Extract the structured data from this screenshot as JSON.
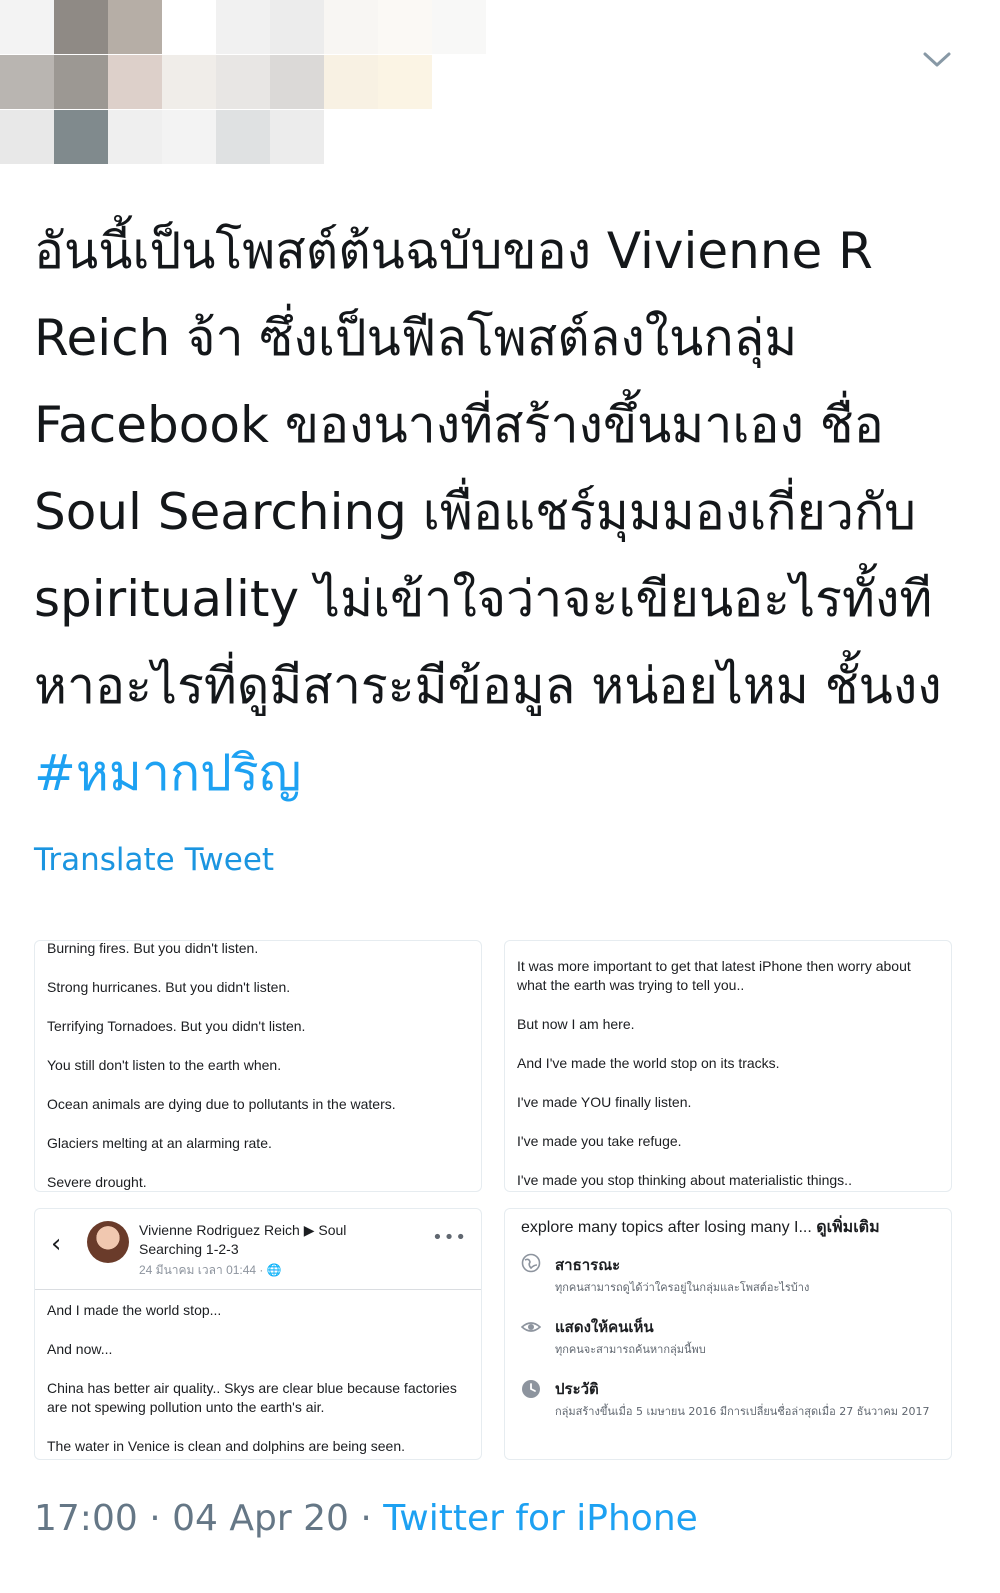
{
  "header": {
    "mosaic_colors": [
      [
        "#f3f3f3",
        "#8f8a85",
        "#b6aea6",
        "#ffffff",
        "#f1f1f1",
        "#ececec",
        "#f8f6f3",
        "#fbf9f5",
        "#f8f8f7",
        "#ffffff"
      ],
      [
        "#b9b5b1",
        "#9c9893",
        "#ddd0ca",
        "#f0ede9",
        "#e8e6e4",
        "#dbd9d7",
        "#f8f1e3",
        "#fbf4e4",
        "#ffffff",
        "#ffffff"
      ],
      [
        "#e8e8e8",
        "#808a8d",
        "#efefef",
        "#f3f3f3",
        "#dfe1e2",
        "#ececec",
        "#ffffff",
        "#ffffff",
        "#ffffff",
        "#ffffff"
      ]
    ],
    "menu_icon": "chevron-down-icon"
  },
  "tweet": {
    "text": "อันนี้เป็นโพสต์ต้นฉบับของ Vivienne R Reich จ้า ซึ่งเป็นฟีลโพสต์ลงในกลุ่ม Facebook ของนางที่สร้างขึ้นมาเอง ชื่อ Soul Searching เพื่อแชร์มุมมองเกี่ยวกับ spirituality ไม่เข้าใจว่าจะเขียนอะไรทั้งที หาอะไรที่ดูมีสาระมีข้อมูล หน่อยไหม ชั้นงง ",
    "hashtag": "#หมากปริญ",
    "translate_label": "Translate Tweet"
  },
  "images": {
    "top_left": [
      "Burning fires. But you didn't listen.",
      "Strong hurricanes. But you didn't listen.",
      "Terrifying Tornadoes. But you didn't listen.",
      "You still don't listen to the earth when.",
      "Ocean animals are dying due to pollutants in the waters.",
      "Glaciers melting at an alarming rate.",
      "Severe drought."
    ],
    "top_right": [
      "It was more important to get that latest iPhone then worry about what the earth was trying to tell you..",
      "But now I am here.",
      "And I've made the world stop on its tracks.",
      "I've made YOU finally listen.",
      "I've made you take refuge.",
      "I've made you stop thinking about materialistic things.."
    ],
    "bottom_left": {
      "author": "Vivienne Rodriguez Reich ▶ Soul Searching 1-2-3",
      "meta": "24 มีนาคม เวลา 01:44 · 🌐",
      "back_icon": "chevron-left-icon",
      "more_icon": "more-icon",
      "lines": [
        "And I made the world stop...",
        "And now...",
        "China has better air quality.. Skys are clear blue because factories are not spewing pollution unto the earth's air.",
        "The water in Venice is clean and dolphins are being seen."
      ]
    },
    "bottom_right": {
      "intro": "explore many topics after losing many I...",
      "see_more": "ดูเพิ่มเติม",
      "items": [
        {
          "icon": "globe-icon",
          "title": "สาธารณะ",
          "desc": "ทุกคนสามารถดูได้ว่าใครอยู่ในกลุ่มและโพสต์อะไรบ้าง"
        },
        {
          "icon": "eye-icon",
          "title": "แสดงให้คนเห็น",
          "desc": "ทุกคนจะสามารถค้นหากลุ่มนี้พบ"
        },
        {
          "icon": "clock-icon",
          "title": "ประวัติ",
          "desc": "กลุ่มสร้างขึ้นเมื่อ 5 เมษายน 2016 มีการเปลี่ยนชื่อล่าสุดเมื่อ 27 ธันวาคม 2017"
        }
      ]
    }
  },
  "footer": {
    "time": "17:00",
    "sep": " · ",
    "date": "04 Apr 20",
    "source": "Twitter for iPhone"
  },
  "colors": {
    "link": "#1da1f2",
    "text": "#14171a",
    "muted": "#657786"
  }
}
